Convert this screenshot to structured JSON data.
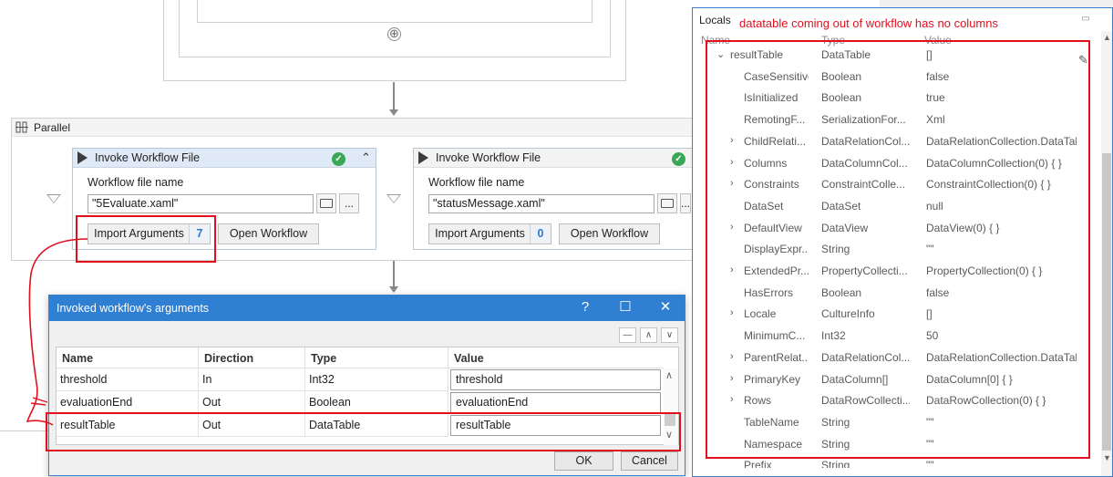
{
  "canvas": {
    "parallel_title": "Parallel",
    "invoke1": {
      "title": "Invoke Workflow File",
      "file_label": "Workflow file name",
      "file_value": "\"5Evaluate.xaml\"",
      "folder_icon": "folder-icon",
      "ellipsis": "...",
      "import_label": "Import Arguments",
      "import_count": "7",
      "open_label": "Open Workflow"
    },
    "invoke2": {
      "title": "Invoke Workflow File",
      "file_label": "Workflow file name",
      "file_value": "\"statusMessage.xaml\"",
      "folder_icon": "folder-icon",
      "ellipsis": "...",
      "import_label": "Import Arguments",
      "import_count": "0",
      "open_label": "Open Workflow"
    },
    "plus_symbol": "⊕"
  },
  "locals": {
    "title": "Locals",
    "annotation": "datatable coming out of workflow has no columns",
    "headers": {
      "name": "Name",
      "type": "Type",
      "value": "Value"
    },
    "rows": [
      {
        "expander": "⌄",
        "name": "resultTable",
        "type": "DataTable",
        "value": "[]"
      },
      {
        "expander": "",
        "name": "CaseSensitive",
        "type": "Boolean",
        "value": "false"
      },
      {
        "expander": "",
        "name": "IsInitialized",
        "type": "Boolean",
        "value": "true"
      },
      {
        "expander": "",
        "name": "RemotingF...",
        "type": "SerializationFor...",
        "value": "Xml"
      },
      {
        "expander": "›",
        "name": "ChildRelati...",
        "type": "DataRelationCol...",
        "value": "DataRelationCollection.DataTab"
      },
      {
        "expander": "›",
        "name": "Columns",
        "type": "DataColumnCol...",
        "value": "DataColumnCollection(0) { }"
      },
      {
        "expander": "›",
        "name": "Constraints",
        "type": "ConstraintColle...",
        "value": "ConstraintCollection(0) { }"
      },
      {
        "expander": "",
        "name": "DataSet",
        "type": "DataSet",
        "value": "null"
      },
      {
        "expander": "›",
        "name": "DefaultView",
        "type": "DataView",
        "value": "DataView(0) { }"
      },
      {
        "expander": "",
        "name": "DisplayExpr...",
        "type": "String",
        "value": "\"\""
      },
      {
        "expander": "›",
        "name": "ExtendedPr...",
        "type": "PropertyCollecti...",
        "value": "PropertyCollection(0) { }"
      },
      {
        "expander": "",
        "name": "HasErrors",
        "type": "Boolean",
        "value": "false"
      },
      {
        "expander": "›",
        "name": "Locale",
        "type": "CultureInfo",
        "value": "[]"
      },
      {
        "expander": "",
        "name": "MinimumC...",
        "type": "Int32",
        "value": "50"
      },
      {
        "expander": "›",
        "name": "ParentRelat...",
        "type": "DataRelationCol...",
        "value": "DataRelationCollection.DataTab"
      },
      {
        "expander": "›",
        "name": "PrimaryKey",
        "type": "DataColumn[]",
        "value": "DataColumn[0] { }"
      },
      {
        "expander": "›",
        "name": "Rows",
        "type": "DataRowCollecti...",
        "value": "DataRowCollection(0) { }"
      },
      {
        "expander": "",
        "name": "TableName",
        "type": "String",
        "value": "\"\""
      },
      {
        "expander": "",
        "name": "Namespace",
        "type": "String",
        "value": "\"\""
      },
      {
        "expander": "",
        "name": "Prefix",
        "type": "String",
        "value": "\"\""
      }
    ]
  },
  "dialog": {
    "title": "Invoked workflow's arguments",
    "help": "?",
    "maximize": "☐",
    "close": "✕",
    "toolbar": {
      "remove": "—",
      "up": "∧",
      "down": "∨"
    },
    "columns": [
      "Name",
      "Direction",
      "Type",
      "Value"
    ],
    "rows": [
      {
        "name": "threshold",
        "direction": "In",
        "type": "Int32",
        "value": "threshold"
      },
      {
        "name": "evaluationEnd",
        "direction": "Out",
        "type": "Boolean",
        "value": "evaluationEnd"
      },
      {
        "name": "resultTable",
        "direction": "Out",
        "type": "DataTable",
        "value": "resultTable"
      }
    ],
    "ok": "OK",
    "cancel": "Cancel"
  },
  "colors": {
    "annotation": "#e0101e",
    "accent": "#2f7fd2",
    "success": "#3aa757"
  }
}
